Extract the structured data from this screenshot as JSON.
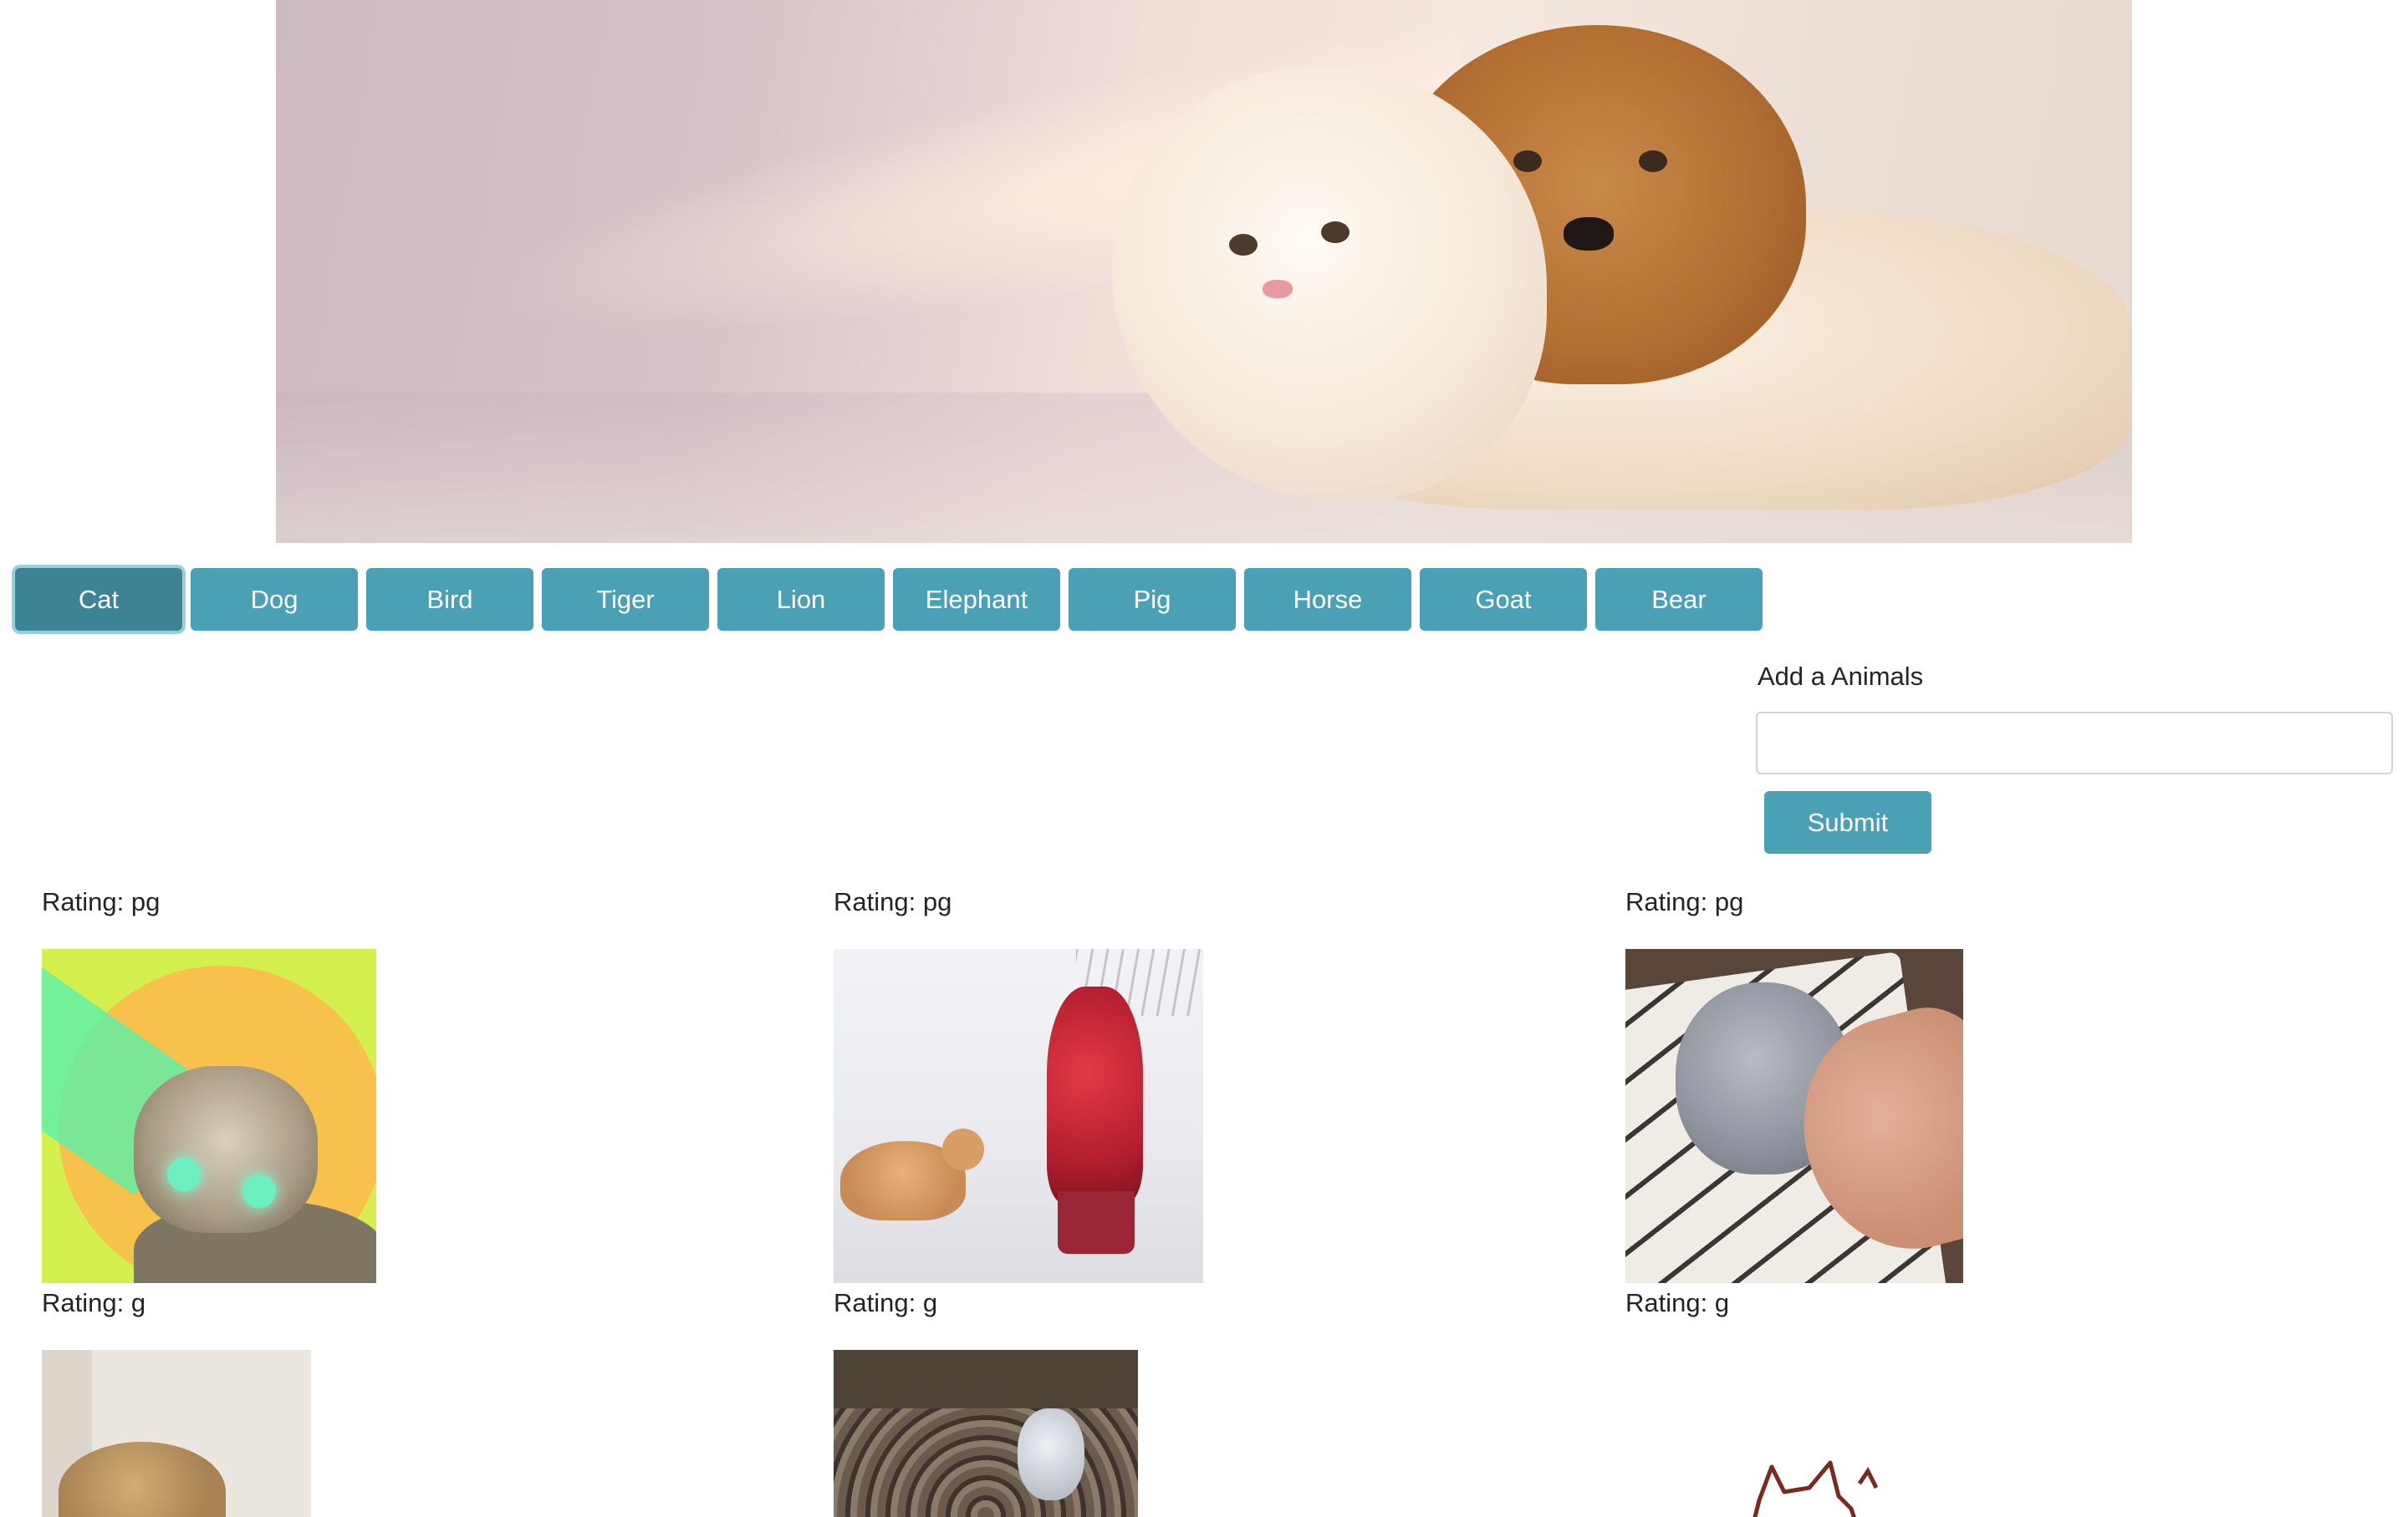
{
  "banner": {
    "alt": "Kitten and puppy cuddling"
  },
  "animal_buttons": [
    {
      "label": "Cat",
      "active": true
    },
    {
      "label": "Dog",
      "active": false
    },
    {
      "label": "Bird",
      "active": false
    },
    {
      "label": "Tiger",
      "active": false
    },
    {
      "label": "Lion",
      "active": false
    },
    {
      "label": "Elephant",
      "active": false
    },
    {
      "label": "Pig",
      "active": false
    },
    {
      "label": "Horse",
      "active": false
    },
    {
      "label": "Goat",
      "active": false
    },
    {
      "label": "Bear",
      "active": false
    }
  ],
  "add_form": {
    "label": "Add a Animals",
    "input_value": "",
    "submit_label": "Submit"
  },
  "gifs": [
    {
      "rating": "Rating: pg"
    },
    {
      "rating": "Rating: pg"
    },
    {
      "rating": "Rating: pg"
    },
    {
      "rating": "Rating: g"
    },
    {
      "rating": "Rating: g"
    },
    {
      "rating": "Rating: g"
    }
  ],
  "colors": {
    "button": "#4aa0b5",
    "button_active": "#3d8396",
    "text": "#212529"
  }
}
